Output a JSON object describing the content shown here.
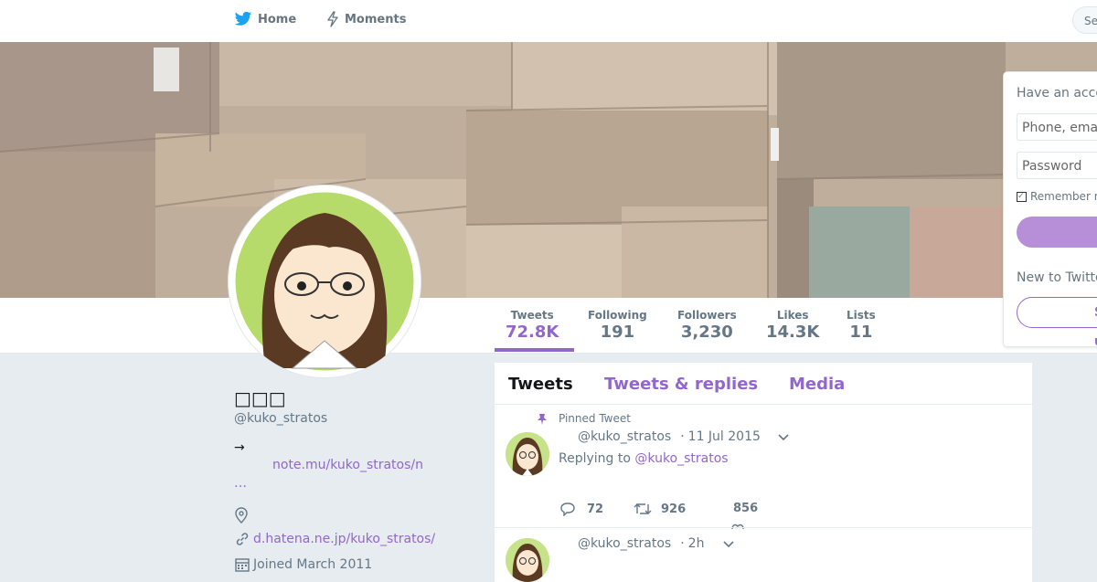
{
  "nav": {
    "home_label": "Home",
    "moments_label": "Moments",
    "search_placeholder": "Se"
  },
  "profile": {
    "name": "□□□",
    "handle": "@kuko_stratos",
    "bio_arrow": "→",
    "bio_link": "note.mu/kuko_stratos/n",
    "bio_more": "…",
    "website": "d.hatena.ne.jp/kuko_stratos/",
    "joined": "Joined March 2011"
  },
  "stats": [
    {
      "label": "Tweets",
      "value": "72.8K"
    },
    {
      "label": "Following",
      "value": "191"
    },
    {
      "label": "Followers",
      "value": "3,230"
    },
    {
      "label": "Likes",
      "value": "14.3K"
    },
    {
      "label": "Lists",
      "value": "11"
    }
  ],
  "tabs": [
    "Tweets",
    "Tweets & replies",
    "Media"
  ],
  "tweets": [
    {
      "pinned_label": "Pinned Tweet",
      "handle": "@kuko_stratos",
      "time": "11 Jul 2015",
      "replying_prefix": "Replying to",
      "replying_handle": "@kuko_stratos",
      "replies": "72",
      "retweets": "926",
      "likes": "856"
    },
    {
      "handle": "@kuko_stratos",
      "time": "2h"
    }
  ],
  "login": {
    "title": "Have an account?",
    "phone_placeholder": "Phone, email or username",
    "password_placeholder": "Password",
    "remember_label": "Remember me",
    "new_label": "New to Twitter?",
    "signup_label": "Sign up"
  },
  "colors": {
    "accent": "#9266cc",
    "background": "#e6ecf0"
  }
}
